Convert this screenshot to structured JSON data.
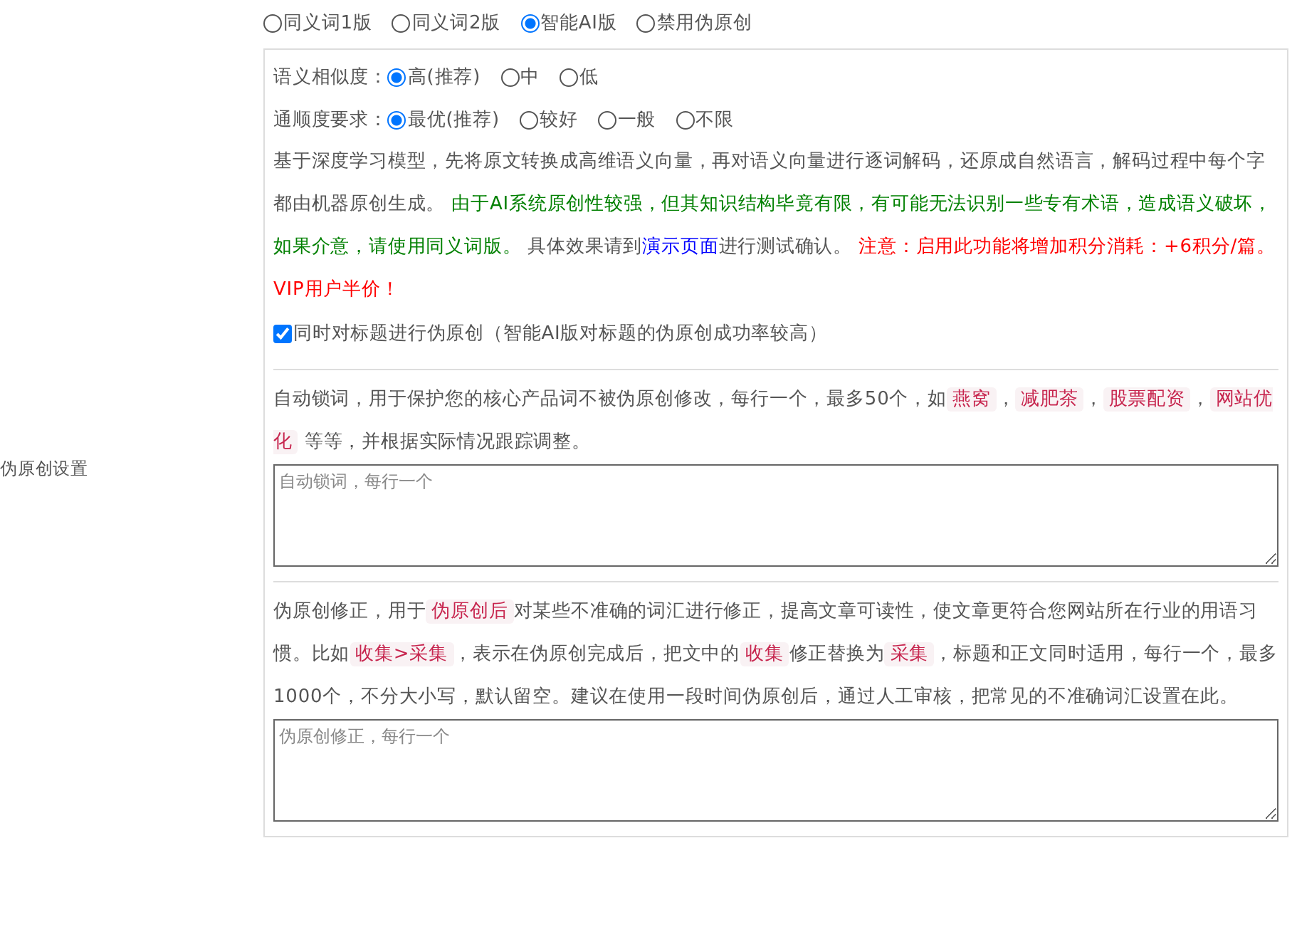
{
  "section_label": "伪原创设置",
  "modes": [
    {
      "label": "同义词1版",
      "selected": false
    },
    {
      "label": "同义词2版",
      "selected": false
    },
    {
      "label": "智能AI版",
      "selected": true
    },
    {
      "label": "禁用伪原创",
      "selected": false
    }
  ],
  "similarity": {
    "label": "语义相似度：",
    "options": [
      {
        "label": "高(推荐)",
        "selected": true
      },
      {
        "label": "中",
        "selected": false
      },
      {
        "label": "低",
        "selected": false
      }
    ]
  },
  "fluency": {
    "label": "通顺度要求：",
    "options": [
      {
        "label": "最优(推荐)",
        "selected": true
      },
      {
        "label": "较好",
        "selected": false
      },
      {
        "label": "一般",
        "selected": false
      },
      {
        "label": "不限",
        "selected": false
      }
    ]
  },
  "ai_description": [
    {
      "kind": "plain",
      "text": "基于深度学习模型，先将原文转换成高维语义向量，再对语义向量进行逐词解码，还原成自然语言，解码过程中每个字都由机器原创生成。 "
    },
    {
      "kind": "success",
      "text": "由于AI系统原创性较强，但其知识结构毕竟有限，有可能无法识别一些专有术语，造成语义破坏，如果介意，请使用同义词版。"
    },
    {
      "kind": "plain",
      "text": " 具体效果请到"
    },
    {
      "kind": "link",
      "text": "演示页面"
    },
    {
      "kind": "plain",
      "text": "进行测试确认。 "
    },
    {
      "kind": "warning",
      "text": "注意：启用此功能将增加积分消耗：+6积分/篇。VIP用户半价！"
    }
  ],
  "title_option": {
    "label": "同时对标题进行伪原创（智能AI版对标题的伪原创成功率较高）",
    "checked": true
  },
  "lock_words": {
    "description": [
      {
        "kind": "plain",
        "text": "自动锁词，用于保护您的核心产品词不被伪原创修改，每行一个，最多50个，如"
      },
      {
        "kind": "code",
        "text": "燕窝"
      },
      {
        "kind": "plain",
        "text": "，"
      },
      {
        "kind": "code",
        "text": "减肥茶"
      },
      {
        "kind": "plain",
        "text": "，"
      },
      {
        "kind": "code",
        "text": "股票配资"
      },
      {
        "kind": "plain",
        "text": "，"
      },
      {
        "kind": "code",
        "text": "网站优化"
      },
      {
        "kind": "plain",
        "text": " 等等，并根据实际情况跟踪调整。"
      }
    ],
    "placeholder": "自动锁词，每行一个"
  },
  "corrections": {
    "description": [
      {
        "kind": "plain",
        "text": "伪原创修正，用于"
      },
      {
        "kind": "code",
        "text": "伪原创后"
      },
      {
        "kind": "plain",
        "text": "对某些不准确的词汇进行修正，提高文章可读性，使文章更符合您网站所在行业的用语习惯。比如"
      },
      {
        "kind": "code",
        "text": "收集>采集"
      },
      {
        "kind": "plain",
        "text": "，表示在伪原创完成后，把文中的"
      },
      {
        "kind": "code",
        "text": "收集"
      },
      {
        "kind": "plain",
        "text": "修正替换为"
      },
      {
        "kind": "code",
        "text": "采集"
      },
      {
        "kind": "plain",
        "text": "，标题和正文同时适用，每行一个，最多1000个，不分大小写，默认留空。建议在使用一段时间伪原创后，通过人工审核，把常见的不准确词汇设置在此。"
      }
    ],
    "placeholder": "伪原创修正，每行一个"
  }
}
